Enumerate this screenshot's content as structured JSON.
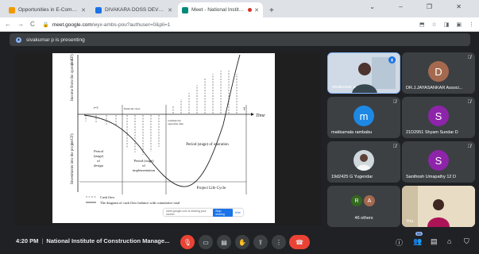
{
  "browser": {
    "tabs": [
      {
        "title": "Opportunities in E-Commerce",
        "fav_color": "#f29900",
        "active": false
      },
      {
        "title": "DIVAKARA DOSS DEVENDRAN",
        "fav_color": "#1a73e8",
        "active": false
      },
      {
        "title": "Meet - National Institute of",
        "fav_color": "#00897b",
        "active": true
      }
    ],
    "new_tab": "+",
    "window_controls": "⌄ – ❐ ✕",
    "url_host": "meet.google.com",
    "url_path": "/wyx-ambs-pou?authuser=0&pli=1",
    "nav": {
      "back": "←",
      "forward": "→",
      "reload": "C"
    },
    "addr_icons": [
      "⬒",
      "☆",
      "◨",
      "▣",
      "⋮"
    ]
  },
  "presenting": {
    "text": "sivakumar p is presenting",
    "icon": "▲"
  },
  "slide": {
    "y_top_label": "Income from the operation",
    "y_top_sign": "(+ CF)",
    "y_bottom_label": "Investments into the project",
    "y_bottom_sign": "(− CF)",
    "time_label": "Time",
    "t_label": "T",
    "t0_label": "t=1",
    "financial_close": "financial close",
    "commercial_op": "commercial",
    "commercial_op2": "operation date",
    "period_design": [
      "Period",
      "(stage)",
      "of",
      "design"
    ],
    "period_impl": [
      "Period (stage)",
      "of",
      "implementation"
    ],
    "period_op": "Period (stage) of operation",
    "life_cycle": "Project Life Cycle",
    "legend_cash": "Cash flow",
    "legend_diagram": "The diagram of cash flow balance with cumulative total",
    "snackbar_text": "meet.google.com is sharing your screen.",
    "snackbar_stop": "Stop sharing",
    "snackbar_hide": "Hide"
  },
  "participants": [
    {
      "name": "sivakumar p",
      "type": "video",
      "selected": true
    },
    {
      "name": "DR.J.JAYASANKAR Associ...",
      "initial": "D",
      "color": "#a5694f"
    },
    {
      "name": "makkamala rambabu",
      "initial": "m",
      "color": "#1e88e5"
    },
    {
      "name": "21D2951 Shyam Sundar D",
      "initial": "S",
      "color": "#8e24aa"
    },
    {
      "name": "19d2425 G Yugendar",
      "type": "photo"
    },
    {
      "name": "Santhosh Umapathy 12 D",
      "initial": "S",
      "color": "#8e24aa"
    },
    {
      "name": "46 others",
      "initials": [
        "R",
        "A"
      ],
      "colors": [
        "#33691e",
        "#a5694f"
      ]
    },
    {
      "name": "You",
      "type": "self"
    }
  ],
  "meeting": {
    "time": "4:20 PM",
    "separator": "|",
    "title": "National Institute of Construction Manage...",
    "participant_count": "56"
  },
  "controls": {
    "mic": "🎙",
    "camera": "▭",
    "captions": "▤",
    "raise_hand": "✋",
    "present": "⇪",
    "more": "⋮",
    "end_call": "☎",
    "info": "ⓘ",
    "people": "👥",
    "chat": "▤",
    "activities": "⌂",
    "host": "⛉"
  }
}
